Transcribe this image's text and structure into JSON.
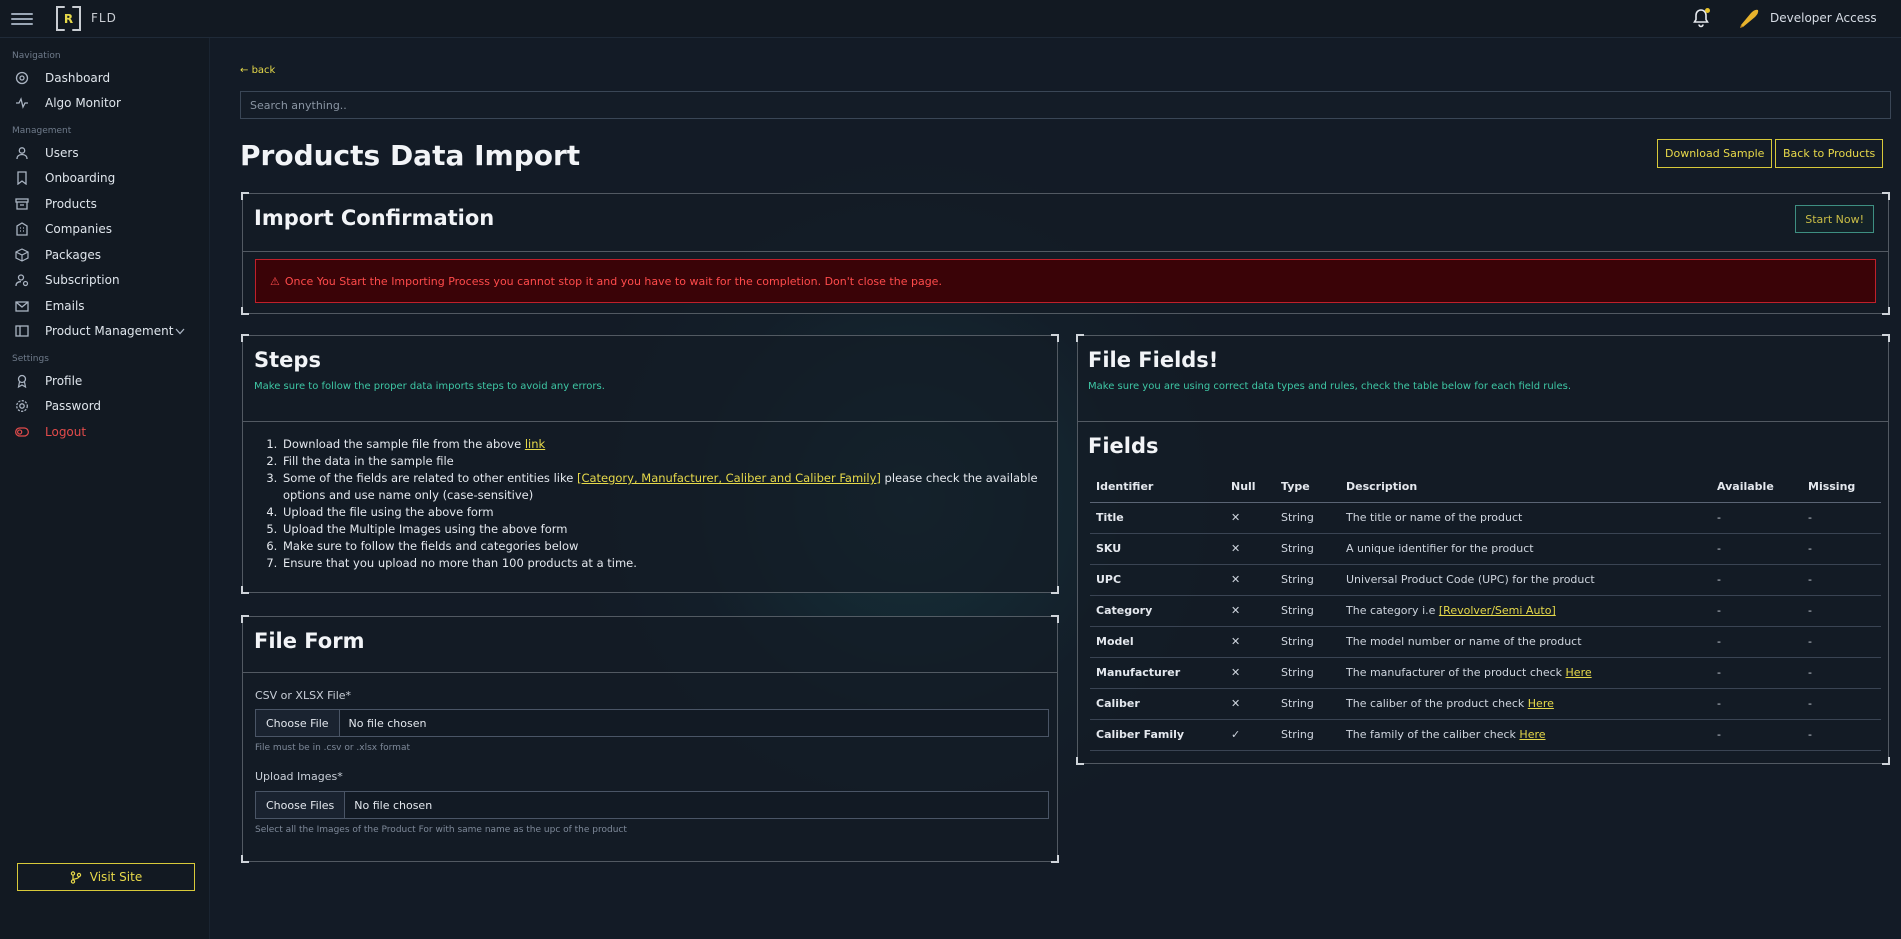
{
  "topbar": {
    "logo_letter": "R",
    "logo_text": "FLD",
    "user_label": "Developer Access"
  },
  "sidebar": {
    "sections": [
      {
        "title": "Navigation",
        "items": [
          {
            "label": "Dashboard",
            "icon": "dashboard-icon"
          },
          {
            "label": "Algo Monitor",
            "icon": "pulse-icon"
          }
        ]
      },
      {
        "title": "Management",
        "items": [
          {
            "label": "Users",
            "icon": "user-icon"
          },
          {
            "label": "Onboarding",
            "icon": "bookmark-icon"
          },
          {
            "label": "Products",
            "icon": "archive-icon"
          },
          {
            "label": "Companies",
            "icon": "building-icon"
          },
          {
            "label": "Packages",
            "icon": "package-icon"
          },
          {
            "label": "Subscription",
            "icon": "user-gear-icon"
          },
          {
            "label": "Emails",
            "icon": "mail-icon"
          },
          {
            "label": "Product Management",
            "icon": "sidebar-icon"
          }
        ]
      },
      {
        "title": "Settings",
        "items": [
          {
            "label": "Profile",
            "icon": "badge-icon"
          },
          {
            "label": "Password",
            "icon": "gear-icon"
          },
          {
            "label": "Logout",
            "icon": "toggle-icon"
          }
        ]
      }
    ],
    "visit_label": "Visit Site"
  },
  "main": {
    "back_label": "back",
    "search_placeholder": "Search anything..",
    "page_title": "Products Data Import",
    "download_sample_label": "Download Sample",
    "back_to_products_label": "Back to Products"
  },
  "import_card": {
    "title": "Import Confirmation",
    "start_label": "Start Now!",
    "alert_text": "Once You Start the Importing Process you cannot stop it and you have to wait for the completion. Don't close the page."
  },
  "steps_card": {
    "title": "Steps",
    "subtitle": "Make sure to follow the proper data imports steps to avoid any errors.",
    "step1_text": "Download the sample file from the above ",
    "step1_link": "link",
    "step2": "Fill the data in the sample file",
    "step3_text": "Some of the fields are related to other entities like ",
    "step3_link": "[Category, Manufacturer, Caliber and Caliber Family]",
    "step3_text_after": " please check the available options and use name only (case-sensitive)",
    "step4": "Upload the file using the above form",
    "step5": "Upload the Multiple Images using the above form",
    "step6": "Make sure to follow the fields and categories below",
    "step7": "Ensure that you upload no more than 100 products at a time."
  },
  "file_form": {
    "title": "File Form",
    "file_label": "CSV or XLSX File*",
    "file_button": "Choose File",
    "file_status": "No file chosen",
    "file_help": "File must be in .csv or .xlsx format",
    "images_label": "Upload Images*",
    "images_button": "Choose Files",
    "images_status": "No file chosen",
    "images_help": "Select all the Images of the Product For with same name as the upc of the product"
  },
  "fields_card": {
    "title": "File Fields!",
    "subtitle": "Make sure you are using correct data types and rules, check the table below for each field rules.",
    "table_title": "Fields",
    "headers": [
      "Identifier",
      "Null",
      "Type",
      "Description",
      "Available",
      "Missing"
    ],
    "rows": [
      {
        "identifier": "Title",
        "null": "✕",
        "type": "String",
        "desc": "The title or name of the product",
        "link": "",
        "available": "-",
        "missing": "-"
      },
      {
        "identifier": "SKU",
        "null": "✕",
        "type": "String",
        "desc": "A unique identifier for the product",
        "link": "",
        "available": "-",
        "missing": "-"
      },
      {
        "identifier": "UPC",
        "null": "✕",
        "type": "String",
        "desc": "Universal Product Code (UPC) for the product",
        "link": "",
        "available": "-",
        "missing": "-"
      },
      {
        "identifier": "Category",
        "null": "✕",
        "type": "String",
        "desc": "The category i.e ",
        "link": "[Revolver/Semi Auto]",
        "available": "-",
        "missing": "-"
      },
      {
        "identifier": "Model",
        "null": "✕",
        "type": "String",
        "desc": "The model number or name of the product",
        "link": "",
        "available": "-",
        "missing": "-"
      },
      {
        "identifier": "Manufacturer",
        "null": "✕",
        "type": "String",
        "desc": "The manufacturer of the product check ",
        "link": "Here",
        "available": "-",
        "missing": "-"
      },
      {
        "identifier": "Caliber",
        "null": "✕",
        "type": "String",
        "desc": "The caliber of the product check ",
        "link": "Here",
        "available": "-",
        "missing": "-"
      },
      {
        "identifier": "Caliber Family",
        "null": "✓",
        "type": "String",
        "desc": "The family of the caliber check ",
        "link": "Here",
        "available": "-",
        "missing": "-"
      }
    ]
  },
  "colors": {
    "accent_yellow": "#e6d94a",
    "teal": "#3ec7a5",
    "danger": "#e24b4b",
    "background": "#131b26"
  }
}
